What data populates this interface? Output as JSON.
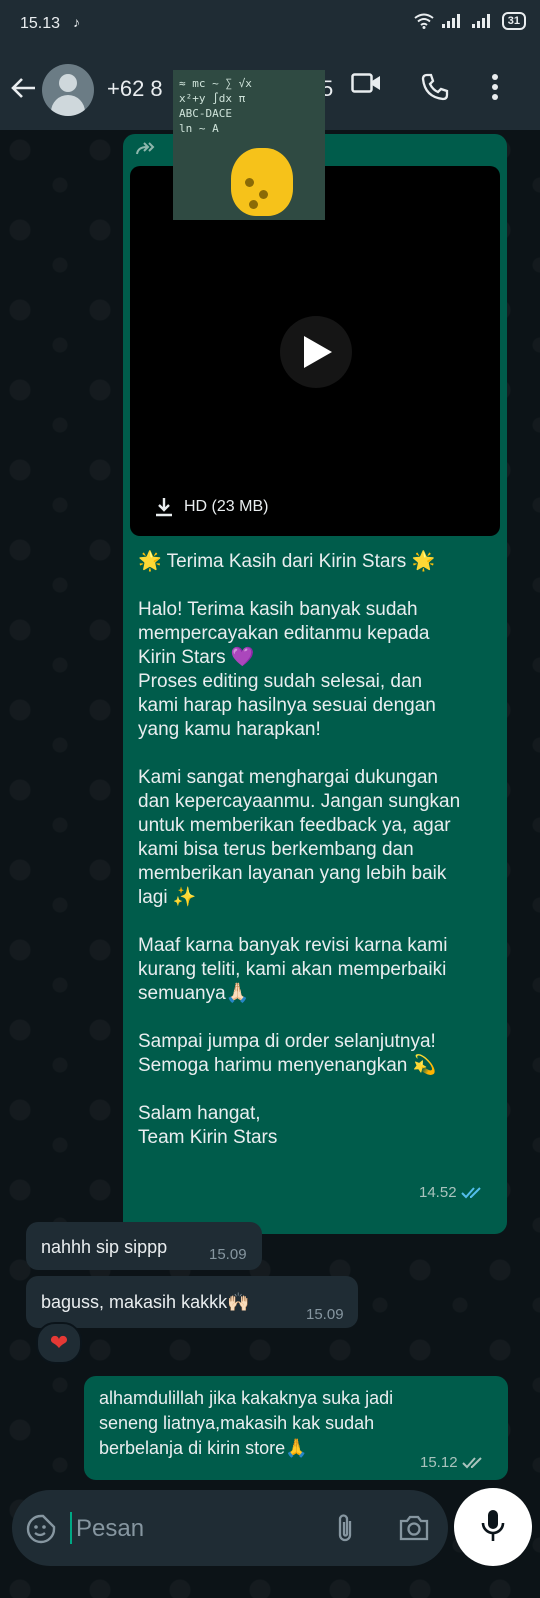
{
  "status_bar": {
    "time": "15.13",
    "battery": "31"
  },
  "header": {
    "contact_name": "+62 8",
    "contact_suffix": "5"
  },
  "thumbnail": {
    "scribble_lines": [
      "≈ mc ~ ∑ √x",
      "x²+y ∫dx π",
      "ABC-DACE",
      "ln ~ A"
    ]
  },
  "messages": [
    {
      "direction": "out",
      "forwarded": true,
      "video_label": "HD (23 MB)",
      "text": "🌟 Terima Kasih dari Kirin Stars 🌟\n\nHalo! Terima kasih banyak sudah\nmempercayakan editanmu kepada\nKirin Stars 💜\nProses editing sudah selesai, dan\nkami harap hasilnya sesuai dengan\nyang kamu harapkan!\n\nKami sangat menghargai dukungan\ndan kepercayaanmu. Jangan sungkan\nuntuk memberikan feedback ya, agar\nkami bisa terus berkembang dan\nmemberikan layanan yang lebih baik\nlagi ✨\n\nMaaf karna banyak revisi karna kami\nkurang teliti, kami akan memperbaiki\nsemuanya🙏🏻\n\nSampai jumpa di order selanjutnya!\nSemoga harimu menyenangkan 💫\n\nSalam hangat,\nTeam Kirin Stars",
      "time": "14.52"
    },
    {
      "direction": "in",
      "text": "nahhh sip sippp",
      "time": "15.09"
    },
    {
      "direction": "in",
      "text": "baguss, makasih kakkk🙌🏻",
      "time": "15.09",
      "reaction": "❤"
    },
    {
      "direction": "out",
      "text": "alhamdulillah jika kakaknya suka jadi\nseneng liatnya,makasih kak sudah\nberbelanja di kirin store🙏",
      "time": "15.12"
    }
  ],
  "composer": {
    "placeholder": "Pesan"
  },
  "colors": {
    "outgoing_bubble": "#005c4b",
    "incoming_bubble": "#1f2c34",
    "read_ticks": "#53bdeb",
    "accent": "#00a884"
  }
}
